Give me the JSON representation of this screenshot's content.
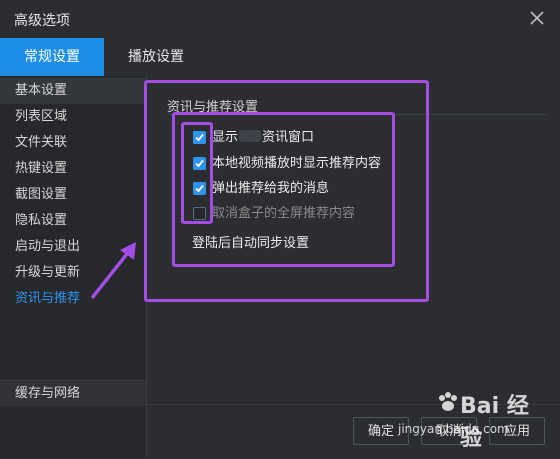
{
  "window": {
    "title": "高级选项"
  },
  "tabs": [
    {
      "label": "常规设置",
      "active": true
    },
    {
      "label": "播放设置",
      "active": false
    }
  ],
  "sidebar": {
    "items": [
      {
        "label": "基本设置"
      },
      {
        "label": "列表区域"
      },
      {
        "label": "文件关联"
      },
      {
        "label": "热键设置"
      },
      {
        "label": "截图设置"
      },
      {
        "label": "隐私设置"
      },
      {
        "label": "启动与退出"
      },
      {
        "label": "升级与更新"
      },
      {
        "label": "资讯与推荐"
      }
    ],
    "bottom_item": "缓存与网络"
  },
  "section": {
    "title": "资讯与推荐设置",
    "options": [
      {
        "label_pre": "显示",
        "label_post": "资讯窗口",
        "checked": true
      },
      {
        "label": "本地视频播放时显示推荐内容",
        "checked": true
      },
      {
        "label": "弹出推荐给我的消息",
        "checked": true
      },
      {
        "label": "取消盒子的全屏推荐内容",
        "checked": false
      }
    ],
    "link": "登陆后自动同步设置"
  },
  "footer": {
    "ok": "确定",
    "cancel": "取消",
    "apply": "应用"
  },
  "watermark": {
    "brand": "Bai 经验",
    "url": "jingyan.baidu.com"
  },
  "colors": {
    "accent": "#1e8de6",
    "highlight": "#a24de3",
    "background": "#2b2d31"
  }
}
